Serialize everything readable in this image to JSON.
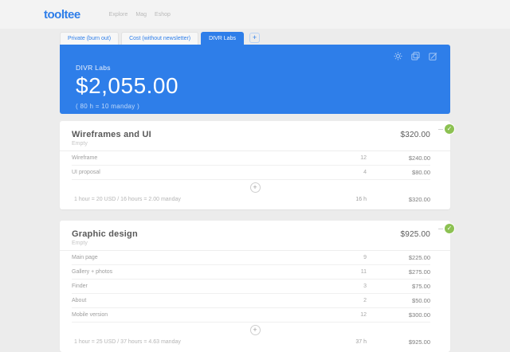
{
  "header": {
    "logo": "tooltee",
    "nav": [
      {
        "label": "Explore"
      },
      {
        "label": "Mag"
      },
      {
        "label": "Eshop"
      }
    ]
  },
  "tabs": [
    {
      "label": "Private (burn out)",
      "active": false
    },
    {
      "label": "Cost (without newsletter)",
      "active": false
    },
    {
      "label": "DIVR Labs",
      "active": true
    }
  ],
  "add_tab_glyph": "+",
  "summary_card": {
    "title": "DIVR Labs",
    "total": "$2,055.00",
    "subtitle": "( 80 h = 10 manday )",
    "icons": [
      "settings",
      "duplicate",
      "edit"
    ]
  },
  "check_glyph": "✓",
  "plus_glyph": "+",
  "sections": [
    {
      "title": "Wireframes and UI",
      "total": "$320.00",
      "subtitle": "Empty",
      "rows": [
        {
          "label": "Wireframe",
          "qty": "12",
          "amount": "$240.00"
        },
        {
          "label": "UI proposal",
          "qty": "4",
          "amount": "$80.00"
        }
      ],
      "footer": {
        "note": "1 hour = 20 USD / 16 hours = 2.00 manday",
        "hours": "16 h",
        "amount": "$320.00"
      }
    },
    {
      "title": "Graphic design",
      "total": "$925.00",
      "subtitle": "Empty",
      "rows": [
        {
          "label": "Main page",
          "qty": "9",
          "amount": "$225.00"
        },
        {
          "label": "Gallery + photos",
          "qty": "11",
          "amount": "$275.00"
        },
        {
          "label": "Finder",
          "qty": "3",
          "amount": "$75.00"
        },
        {
          "label": "About",
          "qty": "2",
          "amount": "$50.00"
        },
        {
          "label": "Mobile version",
          "qty": "12",
          "amount": "$300.00"
        }
      ],
      "footer": {
        "note": "1 hour = 25 USD / 37 hours = 4.63 manday",
        "hours": "37 h",
        "amount": "$925.00"
      }
    }
  ],
  "colors": {
    "accent_blue": "#2e7ee9",
    "badge_green": "#8cc152",
    "page_bg": "#ececec",
    "card_bg": "#ffffff"
  }
}
